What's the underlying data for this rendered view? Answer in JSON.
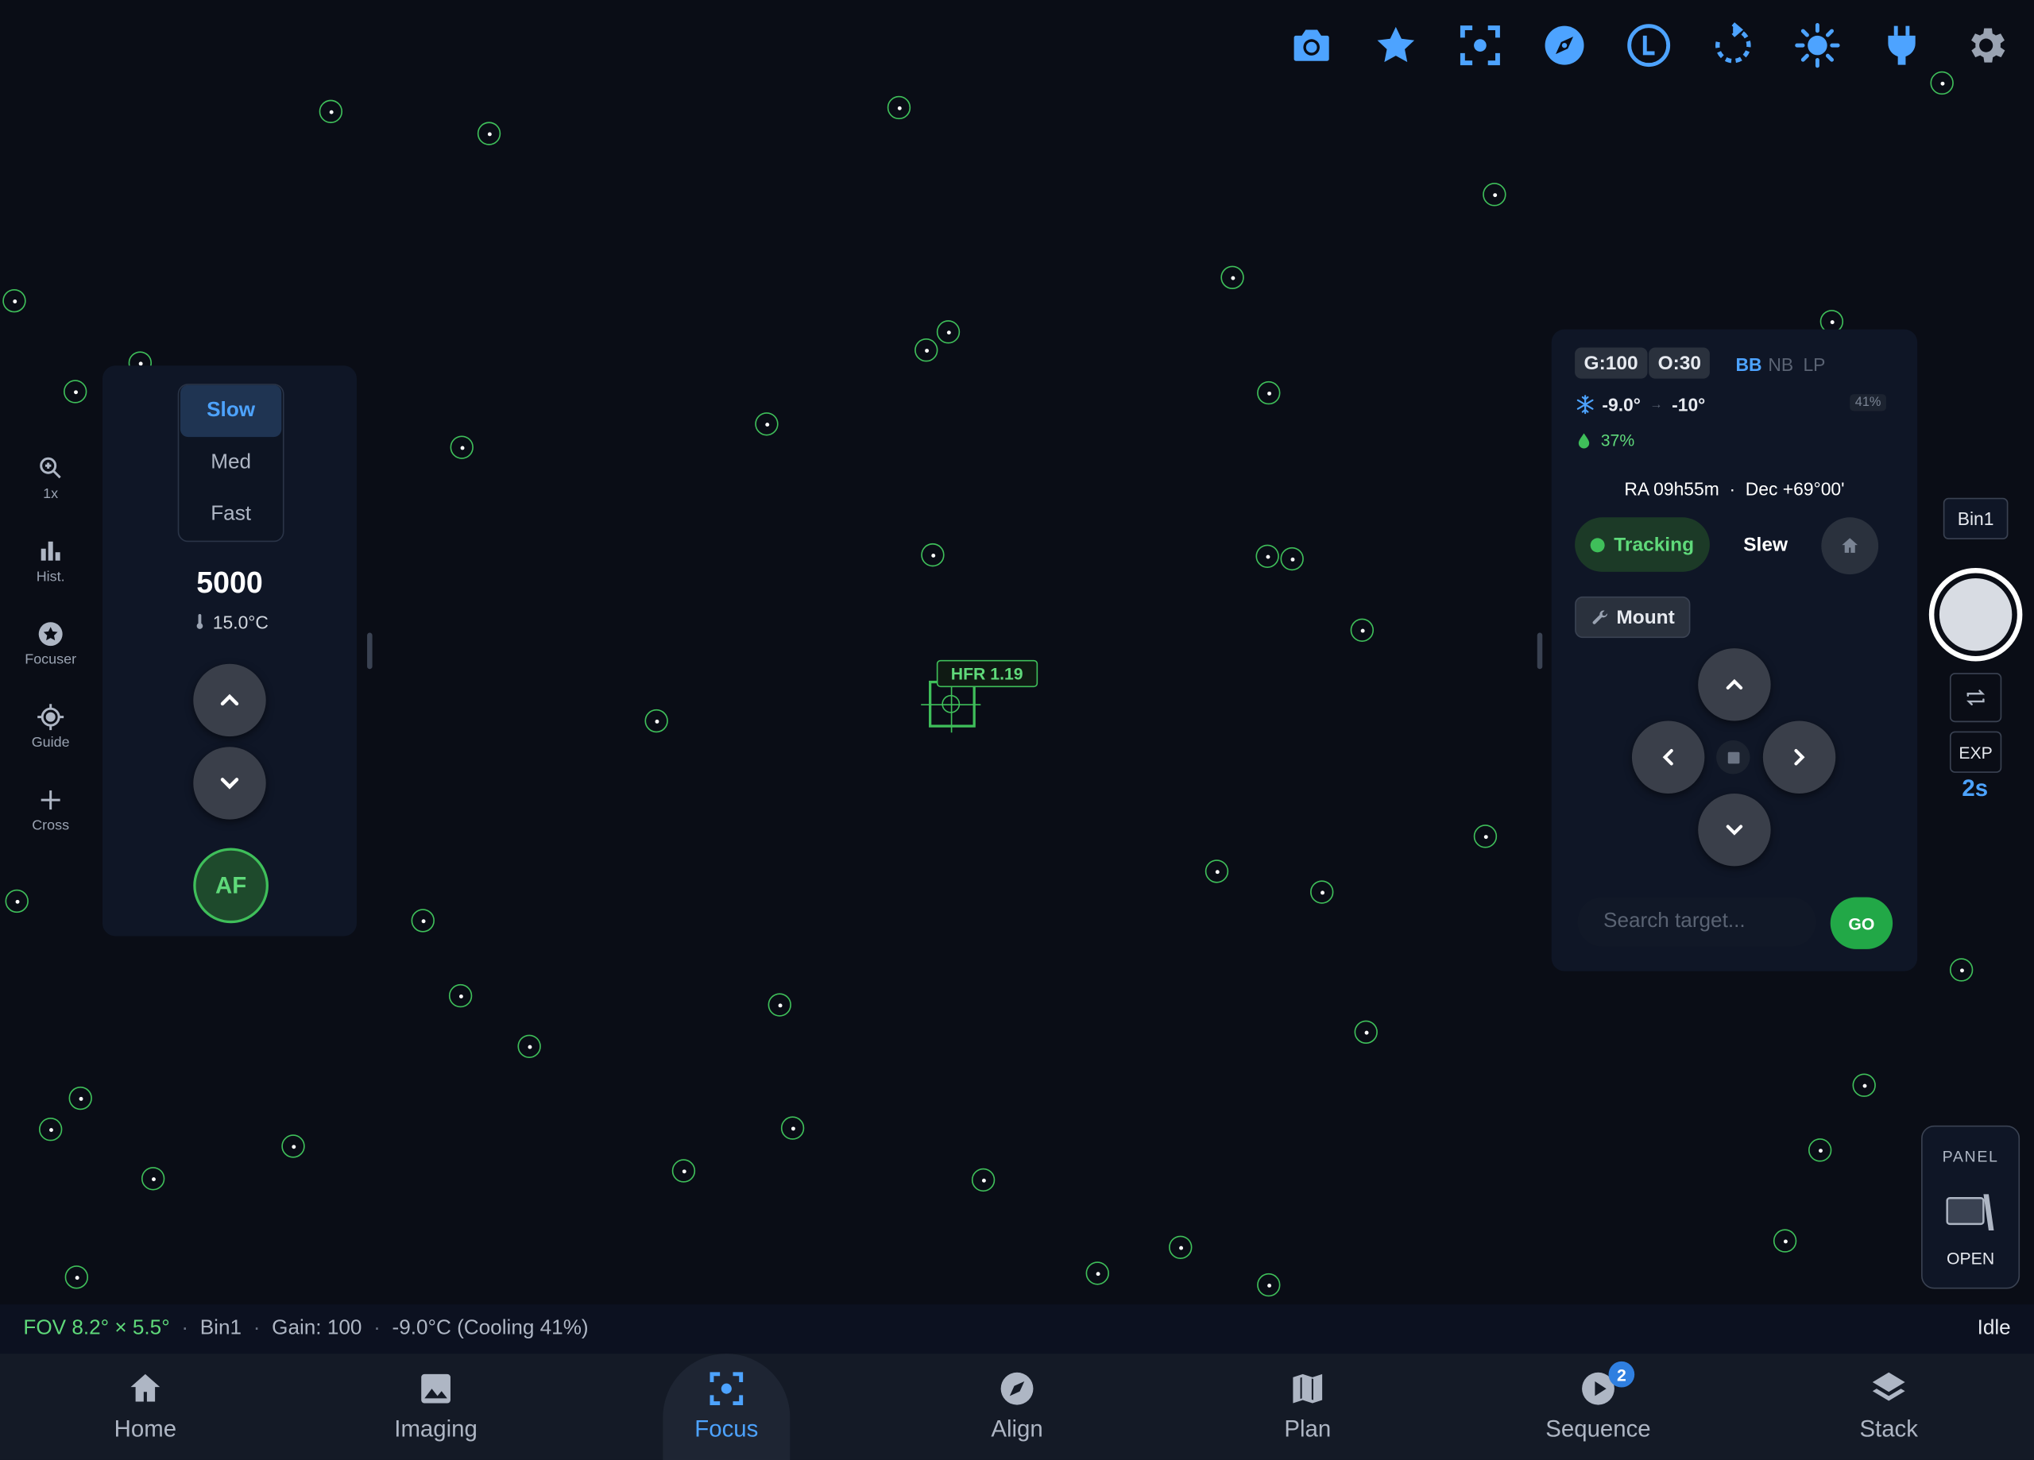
{
  "toolbar": {
    "icons": [
      "camera-icon",
      "star-icon",
      "focus-icon",
      "compass-icon",
      "clock-l-icon",
      "rotate-icon",
      "brightness-icon",
      "plug-icon",
      "gear-icon"
    ],
    "accent": "#4da3ff"
  },
  "left_rail": {
    "items": [
      {
        "label": "1x",
        "icon": "zoom-icon"
      },
      {
        "label": "Hist.",
        "icon": "histogram-icon"
      },
      {
        "label": "Focuser",
        "icon": "focuser-star-icon"
      },
      {
        "label": "Guide",
        "icon": "crosshair-icon"
      },
      {
        "label": "Cross",
        "icon": "plus-icon"
      }
    ]
  },
  "focuser": {
    "speeds": [
      "Slow",
      "Med",
      "Fast"
    ],
    "active_speed": "Slow",
    "position": "5000",
    "temperature": "15.0°C",
    "af_label": "AF"
  },
  "hfr": {
    "label": "HFR 1.19"
  },
  "mount_panel": {
    "gain": "G:100",
    "offset": "O:30",
    "filters": [
      "BB",
      "NB",
      "LP"
    ],
    "active_filter": "BB",
    "cooling": {
      "current": "-9.0°",
      "target": "-10°",
      "power": "41%"
    },
    "humidity": "37%",
    "coords": "RA 09h55m  ·  Dec +69°00'",
    "tracking_label": "Tracking",
    "slew_label": "Slew",
    "mount_label": "Mount",
    "search_placeholder": "Search target...",
    "go_label": "GO"
  },
  "camera": {
    "bin": "Bin1",
    "exp_label": "EXP",
    "exp_value": "2s",
    "panel_top": "PANEL",
    "panel_bottom": "OPEN"
  },
  "status": {
    "fov": "FOV 8.2° × 5.5°",
    "bin": "Bin1",
    "gain": "Gain: 100",
    "temp": "-9.0°C (Cooling 41%)",
    "state": "Idle"
  },
  "nav": {
    "items": [
      {
        "label": "Home",
        "icon": "home-icon"
      },
      {
        "label": "Imaging",
        "icon": "image-icon"
      },
      {
        "label": "Focus",
        "icon": "focus-icon"
      },
      {
        "label": "Align",
        "icon": "compass-icon"
      },
      {
        "label": "Plan",
        "icon": "map-icon"
      },
      {
        "label": "Sequence",
        "icon": "play-icon"
      },
      {
        "label": "Stack",
        "icon": "layers-icon"
      }
    ],
    "active": "Focus",
    "sequence_badge": "2"
  }
}
